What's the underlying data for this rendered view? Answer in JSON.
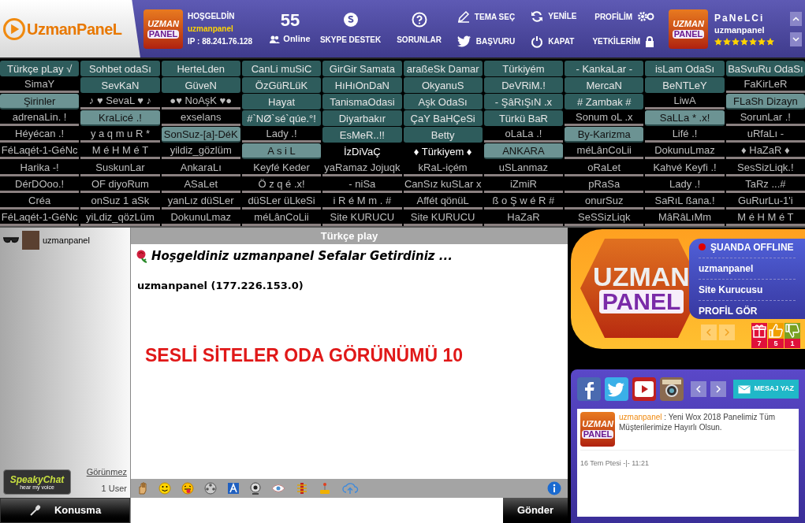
{
  "header": {
    "logo": "UzmanPaneL",
    "avatar_tile": {
      "top": "UZMAN",
      "bottom": "PANEL"
    },
    "greeting": "HOŞGELDİN",
    "username": "uzmanpanel",
    "ip": "IP : 88.241.76.128",
    "online_count": "55",
    "online_label": "Online",
    "nav": [
      {
        "kind": "icon",
        "label": "SKYPE DESTEK"
      },
      {
        "kind": "icon",
        "label": "SORUNLAR"
      },
      {
        "kind": "pair",
        "top": "TEMA SEÇ",
        "bottom": "BAŞVURU"
      },
      {
        "kind": "pair",
        "top": "YENİLE",
        "bottom": "KAPAT"
      },
      {
        "kind": "pair_right",
        "top": "PROFİLİM",
        "bottom": "YETKİLERİM"
      }
    ],
    "profile": {
      "avatar_top": "UZMAN",
      "avatar_bottom": "PANEL",
      "title": "PaNeLCi",
      "name": "uzmanpanel",
      "stars": 7
    }
  },
  "rooms": [
    [
      {
        "label": "Türkçe pLay √",
        "kind": "teal"
      },
      {
        "label": "Sohbet odaSı",
        "kind": "teal"
      },
      {
        "label": "HerteLden",
        "kind": "teal"
      },
      {
        "label": "CanLi muSiC",
        "kind": "teal"
      },
      {
        "label": "GirGir Samata",
        "kind": "teal"
      },
      {
        "label": "araßeSk Damar",
        "kind": "teal"
      },
      {
        "label": "Türkiyém",
        "kind": "teal"
      },
      {
        "label": "- KankaLar -",
        "kind": "teal"
      },
      {
        "label": "isLam OdaSı",
        "kind": "teal"
      },
      {
        "label": "BaSvuRu OdaSı",
        "kind": "teal"
      }
    ],
    [
      {
        "label": "SimaY",
        "kind": "dark"
      },
      {
        "label": "SevKaN",
        "kind": "teal"
      },
      {
        "label": "GüveN",
        "kind": "teal"
      },
      {
        "label": "ÖzGüRLüK",
        "kind": "teal"
      },
      {
        "label": "HıHıOnDaN",
        "kind": "teal"
      },
      {
        "label": "OkyanuS",
        "kind": "teal"
      },
      {
        "label": "DeVRiM.!",
        "kind": "teal"
      },
      {
        "label": "MercaN",
        "kind": "teal"
      },
      {
        "label": "BeNTLeY",
        "kind": "teal"
      },
      {
        "label": "FaKirLeR",
        "kind": "dark"
      }
    ],
    [
      {
        "label": "Şirinler",
        "kind": "light"
      },
      {
        "label": "♪ ♥ SevaL ♥ ♪",
        "kind": "dark"
      },
      {
        "label": "●♥ NoAşK ♥●",
        "kind": "dark"
      },
      {
        "label": "Hayat",
        "kind": "teal"
      },
      {
        "label": "TanismaOdasi",
        "kind": "teal"
      },
      {
        "label": "Aşk OdaSı",
        "kind": "teal"
      },
      {
        "label": "- ŞâRıŞıN .x",
        "kind": "teal"
      },
      {
        "label": "# Zambak #",
        "kind": "teal"
      },
      {
        "label": "LiwA",
        "kind": "dark"
      },
      {
        "label": "FLaSh Dizayn",
        "kind": "light"
      }
    ],
    [
      {
        "label": "adrenaLin. !",
        "kind": "dark"
      },
      {
        "label": "KraLicé .!",
        "kind": "light"
      },
      {
        "label": "exselans",
        "kind": "dark"
      },
      {
        "label": "#`NØ`sé`qúe.°!",
        "kind": "teal"
      },
      {
        "label": "Diyarbakır",
        "kind": "teal"
      },
      {
        "label": "ÇaY BaHÇeSi",
        "kind": "teal"
      },
      {
        "label": "Türkü BaR",
        "kind": "teal"
      },
      {
        "label": "Sonum oL .x",
        "kind": "dark"
      },
      {
        "label": "SaLLa * .x!",
        "kind": "light"
      },
      {
        "label": "SorunLar .!",
        "kind": "dark"
      }
    ],
    [
      {
        "label": "Héyécan .!",
        "kind": "dark"
      },
      {
        "label": "y a q m u R *",
        "kind": "dark"
      },
      {
        "label": "SonSuz-[a]-DéK",
        "kind": "light"
      },
      {
        "label": "Lady .!",
        "kind": "dark"
      },
      {
        "label": "EsMeR..!!",
        "kind": "teal"
      },
      {
        "label": "Betty",
        "kind": "teal"
      },
      {
        "label": "oLaLa .!",
        "kind": "dark"
      },
      {
        "label": "By-Karizma",
        "kind": "light"
      },
      {
        "label": "Lifé .!",
        "kind": "dark"
      },
      {
        "label": "uRfaLı -",
        "kind": "dark"
      }
    ],
    [
      {
        "label": "FéLaqét-1-GéNc",
        "kind": "dark"
      },
      {
        "label": "M é H M é T",
        "kind": "dark"
      },
      {
        "label": "yildiz_gözlüm",
        "kind": "dark"
      },
      {
        "label": "A s i L",
        "kind": "light"
      },
      {
        "label": "İzDiVaÇ",
        "kind": "plain"
      },
      {
        "label": "♦ Türkiyem ♦",
        "kind": "plain"
      },
      {
        "label": "ANKARA",
        "kind": "light"
      },
      {
        "label": "méLânCoLii",
        "kind": "dark"
      },
      {
        "label": "DokunuLmaz",
        "kind": "dark"
      },
      {
        "label": "♦ HaZaR ♦",
        "kind": "dark"
      }
    ],
    [
      {
        "label": "Harika -!",
        "kind": "dark"
      },
      {
        "label": "SuskunLar",
        "kind": "dark"
      },
      {
        "label": "AnkaraLı",
        "kind": "dark"
      },
      {
        "label": "Keyfé Keder",
        "kind": "dark"
      },
      {
        "label": "yaRamaz Jojuqk",
        "kind": "dark"
      },
      {
        "label": "kRaL-içém",
        "kind": "dark"
      },
      {
        "label": "uSLanmaz",
        "kind": "dark"
      },
      {
        "label": "oRaLet",
        "kind": "dark"
      },
      {
        "label": "Kahvé Keyfi .!",
        "kind": "dark"
      },
      {
        "label": "SesSizLiqk.!",
        "kind": "dark"
      }
    ],
    [
      {
        "label": "DérDOoo.!",
        "kind": "dark"
      },
      {
        "label": "OF diyoRum",
        "kind": "dark"
      },
      {
        "label": "ASaLet",
        "kind": "dark"
      },
      {
        "label": "Ö z q é .x!",
        "kind": "dark"
      },
      {
        "label": "- niSa",
        "kind": "dark"
      },
      {
        "label": "CanSız kuSLar x",
        "kind": "dark"
      },
      {
        "label": "iZmiR",
        "kind": "dark"
      },
      {
        "label": "pRaSa",
        "kind": "dark"
      },
      {
        "label": "Lady .!",
        "kind": "dark"
      },
      {
        "label": "TaRz ...#",
        "kind": "dark"
      }
    ],
    [
      {
        "label": "Créa",
        "kind": "dark"
      },
      {
        "label": "onSuz 1 aSk",
        "kind": "dark"
      },
      {
        "label": "yanLız düSLer",
        "kind": "dark"
      },
      {
        "label": "düSLer üLkeSi",
        "kind": "dark"
      },
      {
        "label": "i R é M m . #",
        "kind": "dark"
      },
      {
        "label": "Affét qönüL",
        "kind": "dark"
      },
      {
        "label": "ß o Ş w é R #",
        "kind": "dark"
      },
      {
        "label": "onurSuz",
        "kind": "dark"
      },
      {
        "label": "SaRıL ßana.!",
        "kind": "dark"
      },
      {
        "label": "GuRurLu-1'i",
        "kind": "dark"
      }
    ],
    [
      {
        "label": "FéLaqét-1-GéNc",
        "kind": "dark"
      },
      {
        "label": "yiLdiz_qözLüm",
        "kind": "dark"
      },
      {
        "label": "DokunuLmaz",
        "kind": "dark"
      },
      {
        "label": "méLânCoLii",
        "kind": "dark"
      },
      {
        "label": "Site KURUCU",
        "kind": "dark"
      },
      {
        "label": "Site KURUCU",
        "kind": "dark"
      },
      {
        "label": "HaZaR",
        "kind": "dark"
      },
      {
        "label": "SeSSizLiqk",
        "kind": "dark"
      },
      {
        "label": "MâRâLıMm",
        "kind": "dark"
      },
      {
        "label": "M é H M é T",
        "kind": "dark"
      }
    ]
  ],
  "users": [
    {
      "name": "uzmanpanel"
    }
  ],
  "left_footer": {
    "logo_top": "SpeakyChat",
    "logo_bottom": "hear my voice",
    "invisible_link": "Görünmez",
    "user_count": "1 User",
    "talk_button": "Konusma"
  },
  "chat": {
    "room_title": "Türkçe play",
    "welcome": "Hoşgeldiniz uzmanpanel Sefalar Getirdiniz ...",
    "user_line": "uzmanpanel (177.226.153.0)",
    "banner": "SESLİ SİTELER ODA GÖRÜNÜMÜ 10",
    "send_button": "Gönder"
  },
  "profile_card": {
    "logo_top": "UZMAN",
    "logo_bottom": "PANEL",
    "status": "ŞUANDA OFFLINE",
    "name": "uzmanpanel",
    "role": "Site Kurucusu",
    "link": "PROFİL GÖR",
    "counters": [
      {
        "kind": "gift",
        "value": "7"
      },
      {
        "kind": "like",
        "value": "5"
      },
      {
        "kind": "dislike",
        "value": "1"
      }
    ]
  },
  "social": {
    "write_button": "MESAJ YAZ",
    "messages": [
      {
        "author": "uzmanpanel",
        "separator": ":",
        "text": "Yeni Wox 2018 Panelimiz Tüm Müşterilerimize Hayırlı Olsun.",
        "time": "16 Tem Ptesi -|- 11:21",
        "avatar_top": "UZMAN",
        "avatar_bottom": "PANEL"
      }
    ]
  }
}
